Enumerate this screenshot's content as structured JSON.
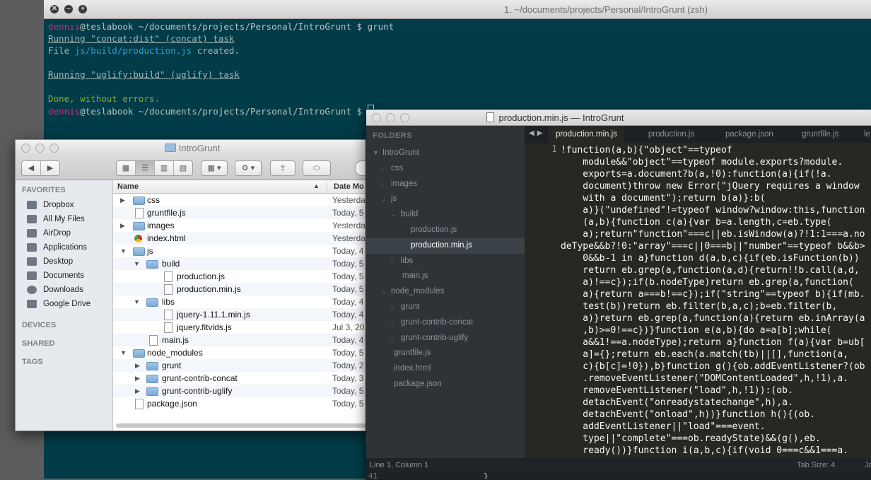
{
  "terminal": {
    "title": "1. ~/documents/projects/Personal/IntroGrunt (zsh)",
    "user": "dennis",
    "host": "@teslabook",
    "cwd": " ~/documents/projects/Personal/IntroGrunt $ ",
    "command": "grunt",
    "line_concat": "Running \"concat:dist\" (concat) task",
    "file_prefix": "File ",
    "file_name": "js/build/production.js",
    "file_suffix": " created.",
    "line_uglify": "Running \"uglify:build\" (uglify) task",
    "done": "Done, without errors."
  },
  "finder": {
    "title": "IntroGrunt",
    "favorites_header": "FAVORITES",
    "favorites": [
      "Dropbox",
      "All My Files",
      "AirDrop",
      "Applications",
      "Desktop",
      "Documents",
      "Downloads",
      "Google Drive"
    ],
    "devices_header": "DEVICES",
    "shared_header": "SHARED",
    "tags_header": "TAGS",
    "col_name": "Name",
    "col_date": "Date Mo",
    "rows": [
      {
        "name": "css",
        "date": "Yesterda"
      },
      {
        "name": "gruntfile.js",
        "date": "Today, 5"
      },
      {
        "name": "images",
        "date": "Yesterda"
      },
      {
        "name": "index.html",
        "date": "Yesterda"
      },
      {
        "name": "js",
        "date": "Today, 4"
      },
      {
        "name": "build",
        "date": "Today, 5"
      },
      {
        "name": "production.js",
        "date": "Today, 5"
      },
      {
        "name": "production.min.js",
        "date": "Today, 5"
      },
      {
        "name": "libs",
        "date": "Today, 4"
      },
      {
        "name": "jquery-1.11.1.min.js",
        "date": "Today, 4"
      },
      {
        "name": "jquery.fitvids.js",
        "date": "Jul 3, 20"
      },
      {
        "name": "main.js",
        "date": "Today, 4"
      },
      {
        "name": "node_modules",
        "date": "Today, 5"
      },
      {
        "name": "grunt",
        "date": "Today, 2"
      },
      {
        "name": "grunt-contrib-concat",
        "date": "Today, 3"
      },
      {
        "name": "grunt-contrib-uglify",
        "date": "Today, 5"
      },
      {
        "name": "package.json",
        "date": "Today, 5"
      }
    ]
  },
  "sublime": {
    "title": "production.min.js — IntroGrunt",
    "folders_header": "FOLDERS",
    "tree": [
      "IntroGrunt",
      "css",
      "images",
      "js",
      "build",
      "production.js",
      "production.min.js",
      "libs",
      "main.js",
      "node_modules",
      "grunt",
      "grunt-contrib-concat",
      "grunt-contrib-uglify",
      "gruntfile.js",
      "index.html",
      "package.json"
    ],
    "tabs": [
      "production.min.js",
      "production.js",
      "package.json",
      "gruntfile.js",
      "le"
    ],
    "line_number": "1",
    "code_lines": [
      "!function(a,b){\"object\"==typeof",
      "    module&&\"object\"==typeof module.exports?module.",
      "    exports=a.document?b(a,!0):function(a){if(!a.",
      "    document)throw new Error(\"jQuery requires a window",
      "    with a document\");return b(a)}:b(",
      "    a)}(\"undefined\"!=typeof window?window:this,function",
      "    (a,b){function c(a){var b=a.length,c=eb.type(",
      "    a);return\"function\"===c||eb.isWindow(a)?!1:1===a.no",
      "deType&&b?!0:\"array\"===c||0===b||\"number\"==typeof b&&b>",
      "    0&&b-1 in a}function d(a,b,c){if(eb.isFunction(b))",
      "    return eb.grep(a,function(a,d){return!!b.call(a,d,",
      "    a)!==c});if(b.nodeType)return eb.grep(a,function(",
      "    a){return a===b!==c});if(\"string\"==typeof b){if(mb.",
      "    test(b))return eb.filter(b,a,c);b=eb.filter(b,",
      "    a)}return eb.grep(a,function(a){return eb.inArray(a",
      "    ,b)>=0!==c})}function e(a,b){do a=a[b];while(",
      "    a&&1!==a.nodeType);return a}function f(a){var b=ub[",
      "    a]={};return eb.each(a.match(tb)||[],function(a,",
      "    c){b[c]=!0}),b}function g(){ob.addEventListener?(ob",
      "    .removeEventListener(\"DOMContentLoaded\",h,!1),a.",
      "    removeEventListener(\"load\",h,!1)):(ob.",
      "    detachEvent(\"onreadystatechange\",h),a.",
      "    detachEvent(\"onload\",h))}function h(){(ob.",
      "    addEventListener||\"load\"===event.",
      "    type||\"complete\"===ob.readyState)&&(g(),eb.",
      "    ready())}function i(a,b,c){if(void 0===c&&1===a."
    ],
    "status_position": "Line 1, Column 1",
    "status_tabsize": "Tab Size: 4",
    "status_lang": "Ja",
    "bg_line": "41",
    "bg_brace": "}"
  }
}
